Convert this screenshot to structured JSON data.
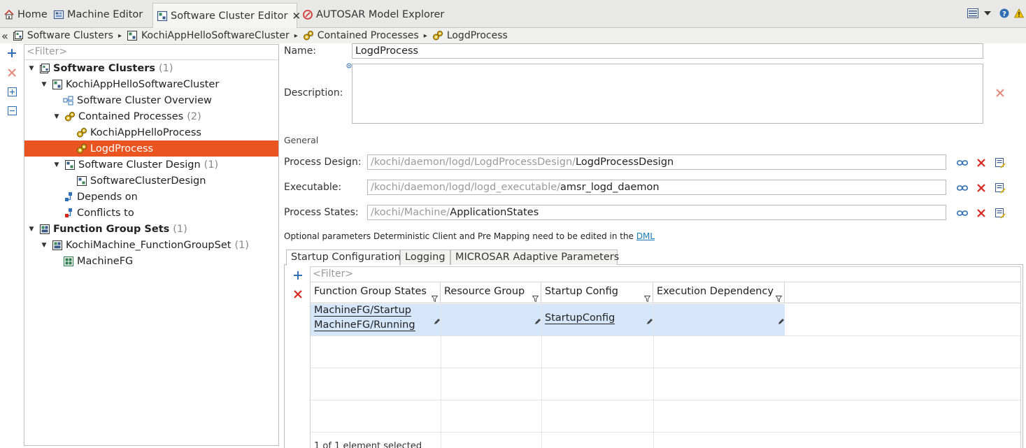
{
  "tabs": [
    {
      "label": "Home",
      "icon": "home-icon"
    },
    {
      "label": "Machine Editor",
      "icon": "machine-editor-icon"
    },
    {
      "label": "Software Cluster Editor",
      "icon": "software-cluster-editor-icon",
      "close": "✕"
    },
    {
      "label": "AUTOSAR Model Explorer",
      "icon": "autosar-explorer-icon"
    }
  ],
  "breadcrumb": {
    "back": "«",
    "items": [
      "Software Clusters",
      "KochiAppHelloSoftwareCluster",
      "Contained Processes",
      "LogdProcess"
    ],
    "separator": "▸"
  },
  "tree": {
    "filter_placeholder": "<Filter>",
    "items": [
      {
        "label": "Software Clusters",
        "count": "(1)"
      },
      {
        "label": "KochiAppHelloSoftwareCluster"
      },
      {
        "label": "Software Cluster Overview"
      },
      {
        "label": "Contained Processes",
        "count": "(2)"
      },
      {
        "label": "KochiAppHelloProcess"
      },
      {
        "label": "LogdProcess"
      },
      {
        "label": "Software Cluster Design",
        "count": "(1)"
      },
      {
        "label": "SoftwareClusterDesign"
      },
      {
        "label": "Depends on"
      },
      {
        "label": "Conflicts to"
      },
      {
        "label": "Function Group Sets",
        "count": "(1)"
      },
      {
        "label": "KochiMachine_FunctionGroupSet",
        "count": "(1)"
      },
      {
        "label": "MachineFG"
      }
    ]
  },
  "form": {
    "name_label": "Name:",
    "name_value": "LogdProcess",
    "description_label": "Description:",
    "general_label": "General",
    "process_design": {
      "label": "Process Design:",
      "prefix": "/kochi/daemon/logd/LogdProcessDesign/",
      "value": "LogdProcessDesign"
    },
    "executable": {
      "label": "Executable:",
      "prefix": "/kochi/daemon/logd/logd_executable/",
      "value": "amsr_logd_daemon"
    },
    "process_states": {
      "label": "Process States:",
      "prefix": "/kochi/Machine/",
      "value": "ApplicationStates"
    },
    "note": "Optional parameters Deterministic Client and Pre Mapping need to be edited in the ",
    "note_link": "DML"
  },
  "subtabs": [
    "Startup Configuration",
    "Logging",
    "MICROSAR Adaptive Parameters"
  ],
  "grid": {
    "filter_placeholder": "<Filter>",
    "columns": [
      "Function Group States",
      "Resource Group",
      "Startup Config",
      "Execution Dependency"
    ],
    "rows": [
      {
        "function_group_states": [
          "MachineFG/Startup",
          "MachineFG/Running"
        ],
        "resource_group": "",
        "startup_config": "StartupConfig",
        "execution_dependency": ""
      }
    ],
    "status": "1 of 1 element selected"
  },
  "colors": {
    "selection": "#e95420",
    "row_highlight": "#d5e6fb",
    "link": "#1a7ab7",
    "delete_red": "#d9261c"
  }
}
